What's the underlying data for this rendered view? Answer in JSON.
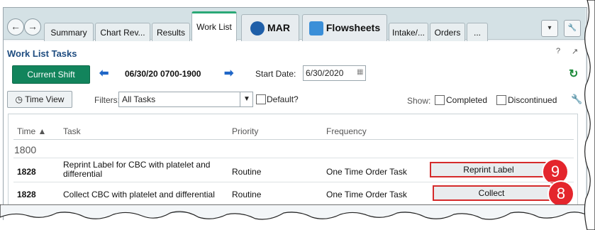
{
  "tabs": {
    "items": [
      "Summary",
      "Chart Rev...",
      "Results",
      "Work List",
      "MAR",
      "Flowsheets",
      "Intake/...",
      "Orders",
      "..."
    ],
    "active": "Work List"
  },
  "panel": {
    "title": "Work List Tasks",
    "current_shift_label": "Current Shift",
    "date_range": "06/30/20 0700-1900",
    "start_date_label": "Start Date:",
    "start_date_value": "6/30/2020",
    "time_view_label": "Time View",
    "filters_label": "Filters:",
    "filter_value": "All Tasks",
    "default_label": "Default?",
    "show_label": "Show:",
    "completed_label": "Completed",
    "discontinued_label": "Discontinued"
  },
  "table": {
    "headers": [
      "Time ▲",
      "Task",
      "Priority",
      "Frequency"
    ],
    "group": "1800",
    "rows": [
      {
        "time": "1828",
        "task": "Reprint Label for CBC with platelet and differential",
        "priority": "Routine",
        "frequency": "One Time Order Task",
        "action": "Reprint Label",
        "callout": "9"
      },
      {
        "time": "1828",
        "task": "Collect CBC with platelet and differential",
        "priority": "Routine",
        "frequency": "One Time Order Task",
        "action": "Collect",
        "callout": "8"
      }
    ]
  },
  "colors": {
    "accent_green": "#12845c",
    "title_blue": "#1e4c80",
    "callout_red": "#e4252c",
    "arrow_blue": "#1f66c7"
  },
  "icons": [
    "back-icon",
    "forward-icon",
    "mar-icon",
    "flowsheets-icon",
    "help-icon",
    "expand-icon",
    "refresh-icon",
    "calendar-icon",
    "clock-icon",
    "wrench-icon",
    "dropdown-icon"
  ]
}
